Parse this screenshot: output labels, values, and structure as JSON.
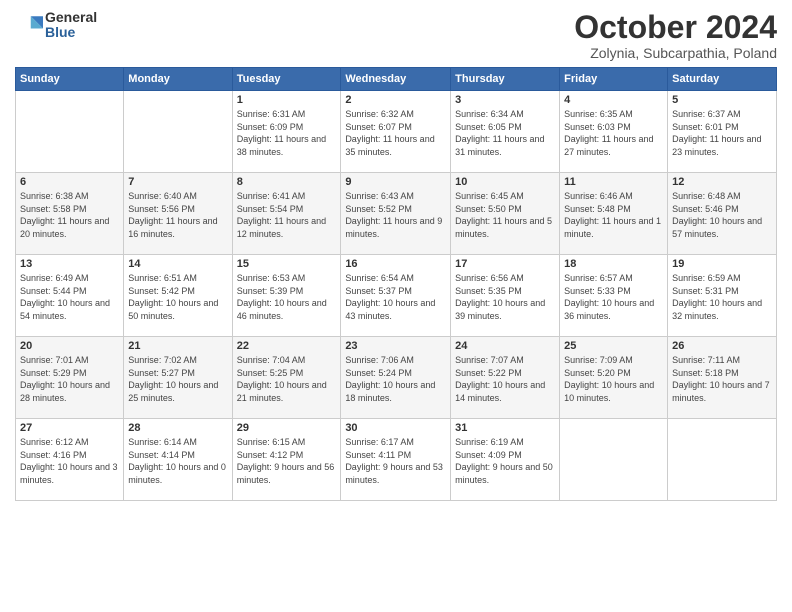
{
  "logo": {
    "general": "General",
    "blue": "Blue"
  },
  "title": "October 2024",
  "subtitle": "Zolynia, Subcarpathia, Poland",
  "header_days": [
    "Sunday",
    "Monday",
    "Tuesday",
    "Wednesday",
    "Thursday",
    "Friday",
    "Saturday"
  ],
  "weeks": [
    [
      {
        "date": "",
        "info": ""
      },
      {
        "date": "",
        "info": ""
      },
      {
        "date": "1",
        "info": "Sunrise: 6:31 AM\nSunset: 6:09 PM\nDaylight: 11 hours and 38 minutes."
      },
      {
        "date": "2",
        "info": "Sunrise: 6:32 AM\nSunset: 6:07 PM\nDaylight: 11 hours and 35 minutes."
      },
      {
        "date": "3",
        "info": "Sunrise: 6:34 AM\nSunset: 6:05 PM\nDaylight: 11 hours and 31 minutes."
      },
      {
        "date": "4",
        "info": "Sunrise: 6:35 AM\nSunset: 6:03 PM\nDaylight: 11 hours and 27 minutes."
      },
      {
        "date": "5",
        "info": "Sunrise: 6:37 AM\nSunset: 6:01 PM\nDaylight: 11 hours and 23 minutes."
      }
    ],
    [
      {
        "date": "6",
        "info": "Sunrise: 6:38 AM\nSunset: 5:58 PM\nDaylight: 11 hours and 20 minutes."
      },
      {
        "date": "7",
        "info": "Sunrise: 6:40 AM\nSunset: 5:56 PM\nDaylight: 11 hours and 16 minutes."
      },
      {
        "date": "8",
        "info": "Sunrise: 6:41 AM\nSunset: 5:54 PM\nDaylight: 11 hours and 12 minutes."
      },
      {
        "date": "9",
        "info": "Sunrise: 6:43 AM\nSunset: 5:52 PM\nDaylight: 11 hours and 9 minutes."
      },
      {
        "date": "10",
        "info": "Sunrise: 6:45 AM\nSunset: 5:50 PM\nDaylight: 11 hours and 5 minutes."
      },
      {
        "date": "11",
        "info": "Sunrise: 6:46 AM\nSunset: 5:48 PM\nDaylight: 11 hours and 1 minute."
      },
      {
        "date": "12",
        "info": "Sunrise: 6:48 AM\nSunset: 5:46 PM\nDaylight: 10 hours and 57 minutes."
      }
    ],
    [
      {
        "date": "13",
        "info": "Sunrise: 6:49 AM\nSunset: 5:44 PM\nDaylight: 10 hours and 54 minutes."
      },
      {
        "date": "14",
        "info": "Sunrise: 6:51 AM\nSunset: 5:42 PM\nDaylight: 10 hours and 50 minutes."
      },
      {
        "date": "15",
        "info": "Sunrise: 6:53 AM\nSunset: 5:39 PM\nDaylight: 10 hours and 46 minutes."
      },
      {
        "date": "16",
        "info": "Sunrise: 6:54 AM\nSunset: 5:37 PM\nDaylight: 10 hours and 43 minutes."
      },
      {
        "date": "17",
        "info": "Sunrise: 6:56 AM\nSunset: 5:35 PM\nDaylight: 10 hours and 39 minutes."
      },
      {
        "date": "18",
        "info": "Sunrise: 6:57 AM\nSunset: 5:33 PM\nDaylight: 10 hours and 36 minutes."
      },
      {
        "date": "19",
        "info": "Sunrise: 6:59 AM\nSunset: 5:31 PM\nDaylight: 10 hours and 32 minutes."
      }
    ],
    [
      {
        "date": "20",
        "info": "Sunrise: 7:01 AM\nSunset: 5:29 PM\nDaylight: 10 hours and 28 minutes."
      },
      {
        "date": "21",
        "info": "Sunrise: 7:02 AM\nSunset: 5:27 PM\nDaylight: 10 hours and 25 minutes."
      },
      {
        "date": "22",
        "info": "Sunrise: 7:04 AM\nSunset: 5:25 PM\nDaylight: 10 hours and 21 minutes."
      },
      {
        "date": "23",
        "info": "Sunrise: 7:06 AM\nSunset: 5:24 PM\nDaylight: 10 hours and 18 minutes."
      },
      {
        "date": "24",
        "info": "Sunrise: 7:07 AM\nSunset: 5:22 PM\nDaylight: 10 hours and 14 minutes."
      },
      {
        "date": "25",
        "info": "Sunrise: 7:09 AM\nSunset: 5:20 PM\nDaylight: 10 hours and 10 minutes."
      },
      {
        "date": "26",
        "info": "Sunrise: 7:11 AM\nSunset: 5:18 PM\nDaylight: 10 hours and 7 minutes."
      }
    ],
    [
      {
        "date": "27",
        "info": "Sunrise: 6:12 AM\nSunset: 4:16 PM\nDaylight: 10 hours and 3 minutes."
      },
      {
        "date": "28",
        "info": "Sunrise: 6:14 AM\nSunset: 4:14 PM\nDaylight: 10 hours and 0 minutes."
      },
      {
        "date": "29",
        "info": "Sunrise: 6:15 AM\nSunset: 4:12 PM\nDaylight: 9 hours and 56 minutes."
      },
      {
        "date": "30",
        "info": "Sunrise: 6:17 AM\nSunset: 4:11 PM\nDaylight: 9 hours and 53 minutes."
      },
      {
        "date": "31",
        "info": "Sunrise: 6:19 AM\nSunset: 4:09 PM\nDaylight: 9 hours and 50 minutes."
      },
      {
        "date": "",
        "info": ""
      },
      {
        "date": "",
        "info": ""
      }
    ]
  ]
}
